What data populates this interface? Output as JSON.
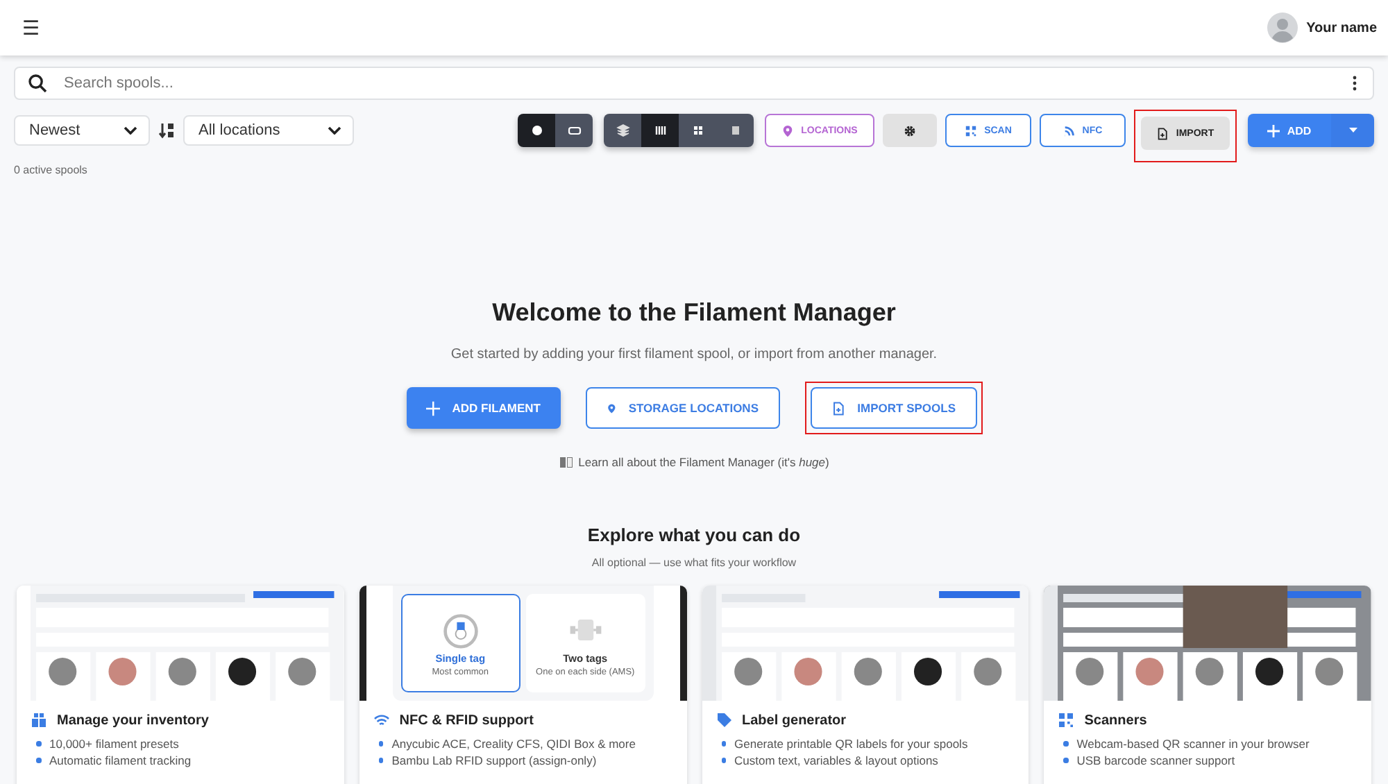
{
  "header": {
    "menu_icon": "☰",
    "user_name": "Your name"
  },
  "search": {
    "placeholder": "Search spools..."
  },
  "filters": {
    "sort": "Newest",
    "location": "All locations"
  },
  "view_groups": [
    {
      "items": [
        {
          "selected": true
        },
        {
          "selected": false
        }
      ]
    },
    {
      "items": [
        {
          "selected": false
        },
        {
          "selected": true
        },
        {
          "selected": false
        },
        {
          "selected": false
        }
      ]
    }
  ],
  "toolbar": [
    {
      "kind": "purple",
      "label": "LOCATIONS",
      "highlighted": false
    },
    {
      "kind": "settings",
      "highlighted": false
    },
    {
      "kind": "outline",
      "label": "SCAN",
      "highlighted": false
    },
    {
      "kind": "outline",
      "label": "NFC",
      "highlighted": false
    },
    {
      "kind": "grey",
      "label": "IMPORT",
      "highlighted": true
    },
    {
      "kind": "primary",
      "label": "ADD",
      "highlighted": false
    }
  ],
  "count": "0 active spools",
  "welcome": {
    "title": "Welcome to the Filament Manager",
    "subtitle": "Get started by adding your first filament spool, or import from another manager.",
    "buttons": [
      {
        "kind": "primary",
        "label": "ADD FILAMENT",
        "highlighted": false
      },
      {
        "kind": "outline",
        "label": "STORAGE LOCATIONS",
        "highlighted": false
      },
      {
        "kind": "outline",
        "label": "IMPORT SPOOLS",
        "highlighted": true
      }
    ],
    "learn": "Learn all about the Filament Manager (it's *huge*)"
  },
  "explore": {
    "title": "Explore what you can do",
    "subtitle": "All optional — use what fits your workflow"
  },
  "cards": [
    {
      "media": {
        "kind": "picture"
      },
      "title": "Manage your inventory",
      "bullets": [
        "10,000+ filament presets",
        "Automatic filament tracking"
      ]
    },
    {
      "media": {
        "kind": "tag-options",
        "options": [
          {
            "title": "Single tag",
            "note": "Most common",
            "selected": true
          },
          {
            "title": "Two tags",
            "note": "One on each side (AMS)",
            "selected": false
          }
        ]
      },
      "title": "NFC & RFID support",
      "bullets": [
        "Anycubic ACE, Creality CFS, QIDI Box & more",
        "Bambu Lab RFID support (assign-only)"
      ]
    },
    {
      "media": {
        "kind": "picture"
      },
      "title": "Label generator",
      "bullets": [
        "Generate printable QR labels for your spools",
        "Custom text, variables & layout options"
      ]
    },
    {
      "media": {
        "kind": "picture"
      },
      "title": "Scanners",
      "bullets": [
        "Webcam-based QR scanner in your browser",
        "USB barcode scanner support"
      ]
    }
  ]
}
